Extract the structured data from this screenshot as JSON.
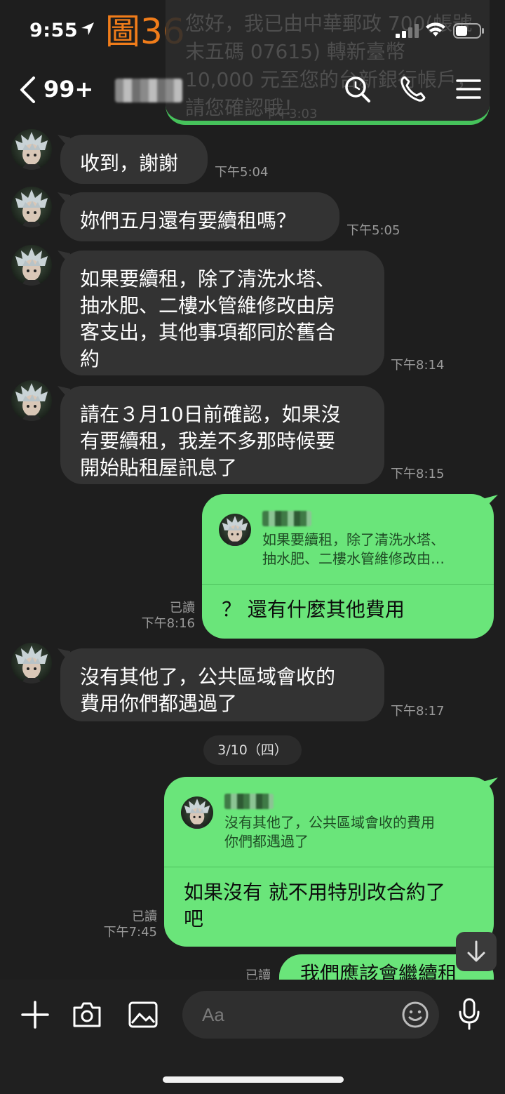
{
  "status_bar": {
    "time": "9:55"
  },
  "figure_label": "圖36",
  "notification": {
    "text": "您好，我已由中華郵政 700(帳號末五碼 07615) 轉新臺幣 10,000 元至您的台新銀行帳戶，請您確認哦！",
    "time": "下午3:03"
  },
  "header": {
    "unread_count": "99+"
  },
  "icons": {
    "back": "chevron-left-icon",
    "search": "search-icon",
    "call": "phone-icon",
    "menu": "hamburger-menu-icon",
    "add": "plus-icon",
    "camera": "camera-icon",
    "gallery": "image-icon",
    "emoji": "emoji-icon",
    "mic": "microphone-icon",
    "scroll": "arrow-down-icon"
  },
  "messages": {
    "m1": {
      "text": "收到，謝謝",
      "time": "下午5:04"
    },
    "m2": {
      "text": "妳們五月還有要續租嗎？",
      "time": "下午5:05"
    },
    "m3": {
      "lines": [
        "如果要續租，除了清洗水塔、",
        "抽水肥、二樓水管維修改由房",
        "客支出，其他事項都同於舊合",
        "約"
      ],
      "time": "下午8:14"
    },
    "m4": {
      "lines": [
        "請在３月10日前確認，如果沒",
        "有要續租，我差不多那時候要",
        "開始貼租屋訊息了"
      ],
      "time": "下午8:15"
    },
    "m5": {
      "quote_lines": [
        "如果要續租，除了清洗水塔、",
        "抽水肥、二樓水管維修改由…"
      ],
      "text": "？ 還有什麼其他費用",
      "read": "已讀",
      "time": "下午8:16"
    },
    "m6": {
      "lines": [
        "沒有其他了，公共區域會收的",
        "費用你們都遇過了"
      ],
      "time": "下午8:17"
    },
    "date": "3/10（四）",
    "m7": {
      "quote_lines": [
        "沒有其他了，公共區域會收的費用",
        "你們都遇過了"
      ],
      "lines": [
        "如果沒有 就不用特別改合約了",
        "吧"
      ],
      "read": "已讀",
      "time": "下午7:45"
    },
    "m8": {
      "text": "我們應該會繼續租",
      "read": "已讀"
    }
  },
  "input": {
    "placeholder": "Aa"
  },
  "colors": {
    "bubble_out": "#6ae57a",
    "bubble_in": "#333333",
    "background": "#1e1e1e",
    "figure_label": "#f07c1a"
  }
}
